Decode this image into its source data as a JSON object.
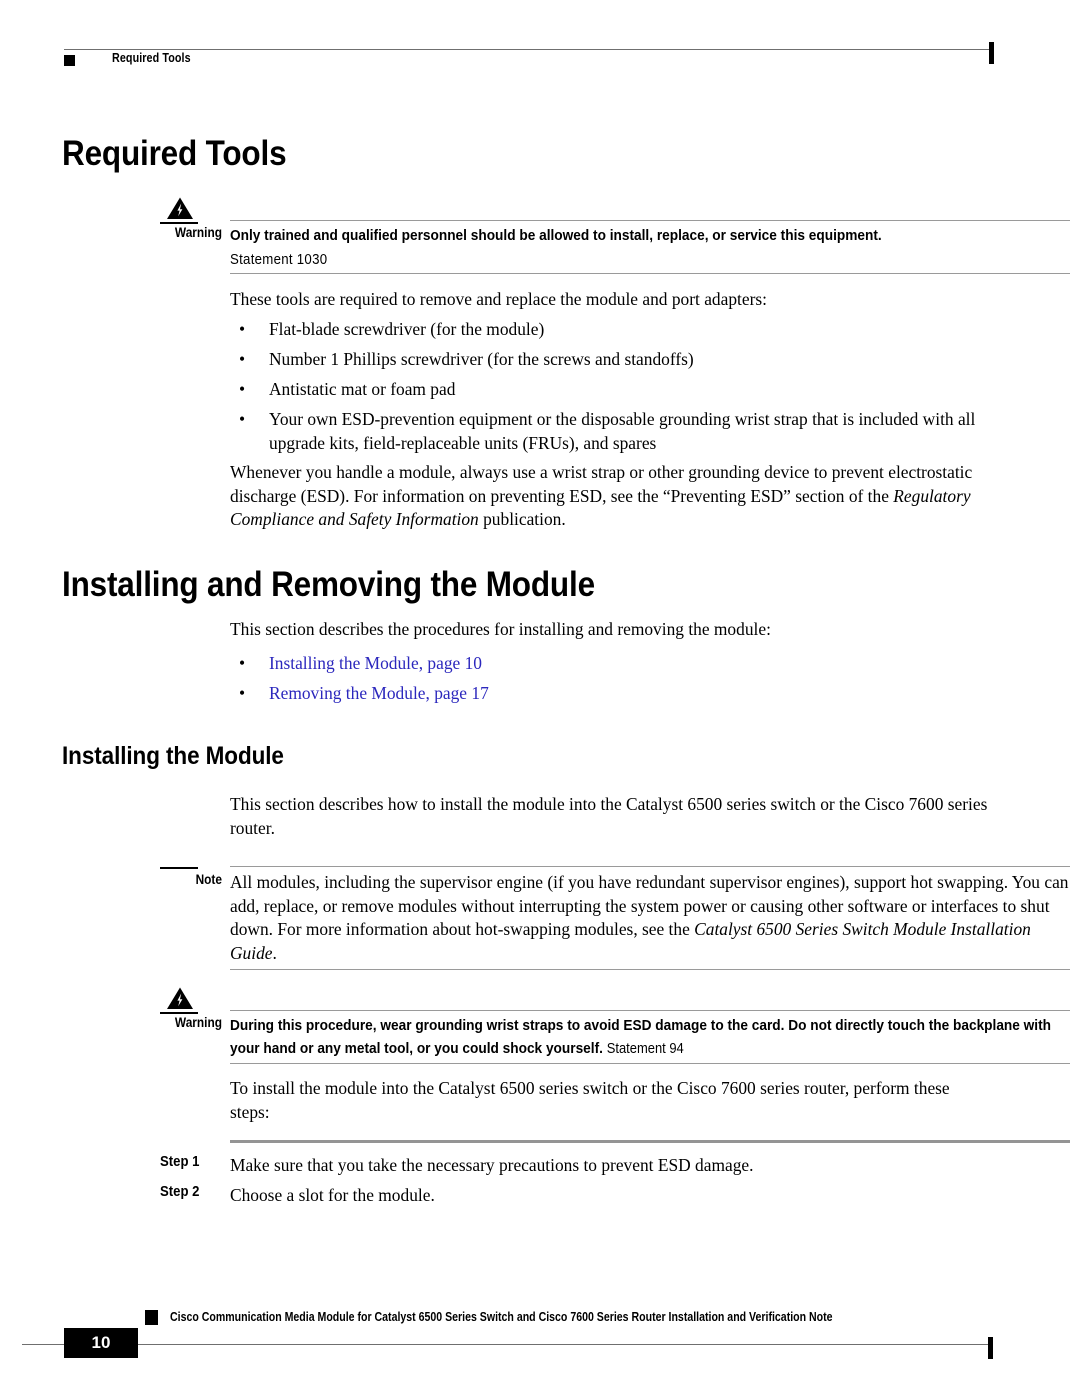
{
  "running_head": {
    "text": "Required Tools",
    "square_icon": "filled-square-icon",
    "edge_marker": "change-bar-marker"
  },
  "sections": {
    "required_tools": {
      "heading": "Required Tools",
      "warning": {
        "label": "Warning",
        "icon": "warning-triangle-icon",
        "text": "Only trained and qualified personnel should be allowed to install, replace, or service this equipment.",
        "statement": "Statement 1030"
      },
      "intro": "These tools are required to remove and replace the module and port adapters:",
      "tools": [
        "Flat-blade screwdriver (for the module)",
        "Number 1 Phillips screwdriver (for the screws and standoffs)",
        "Antistatic mat or foam pad",
        "Your own ESD-prevention equipment or the disposable grounding wrist strap that is included with all upgrade kits, field-replaceable units (FRUs), and spares"
      ],
      "esd_paragraph_part1": "Whenever you handle a module, always use a wrist strap or other grounding device to prevent electrostatic discharge (ESD). For information on preventing ESD, see the “Preventing ESD” section of the ",
      "esd_paragraph_italic": "Regulatory Compliance and Safety Information",
      "esd_paragraph_part2": " publication."
    },
    "installing_removing": {
      "heading": "Installing and Removing the Module",
      "intro": "This section describes the procedures for installing and removing the module:",
      "links": [
        "Installing the Module, page 10",
        "Removing the Module, page 17"
      ]
    },
    "installing_module": {
      "heading": "Installing the Module",
      "intro": "This section describes how to install the module into the Catalyst 6500 series switch or the Cisco 7600 series router.",
      "note": {
        "label": "Note",
        "text_part1": "All modules, including the supervisor engine (if you have redundant supervisor engines), support hot swapping. You can add, replace, or remove modules without interrupting the system power or causing other software or interfaces to shut down. For more information about hot-swapping modules, see the ",
        "text_italic": "Catalyst 6500 Series Switch Module Installation Guide",
        "text_part2": "."
      },
      "warning": {
        "label": "Warning",
        "icon": "warning-triangle-icon",
        "text": "During this procedure, wear grounding wrist straps to avoid ESD damage to the card. Do not directly touch the backplane with your hand or any metal tool, or you could shock yourself. ",
        "statement": "Statement 94"
      },
      "procedure_intro": "To install the module into the Catalyst 6500 series switch or the Cisco 7600 series router, perform these steps:",
      "steps": [
        {
          "label": "Step 1",
          "text": "Make sure that you take the necessary precautions to prevent ESD damage."
        },
        {
          "label": "Step 2",
          "text": "Choose a slot for the module."
        }
      ]
    }
  },
  "footer": {
    "page_number": "10",
    "document_title": "Cisco Communication Media Module for Catalyst 6500 Series Switch and Cisco 7600 Series Router Installation and Verification Note",
    "square_icon": "filled-square-icon",
    "edge_marker": "change-bar-marker"
  },
  "colors": {
    "link": "#2b27bd",
    "rule": "#6f6f6f",
    "admonition_rule": "#9a9a9a",
    "step_rule": "#949494",
    "text": "#000000"
  }
}
